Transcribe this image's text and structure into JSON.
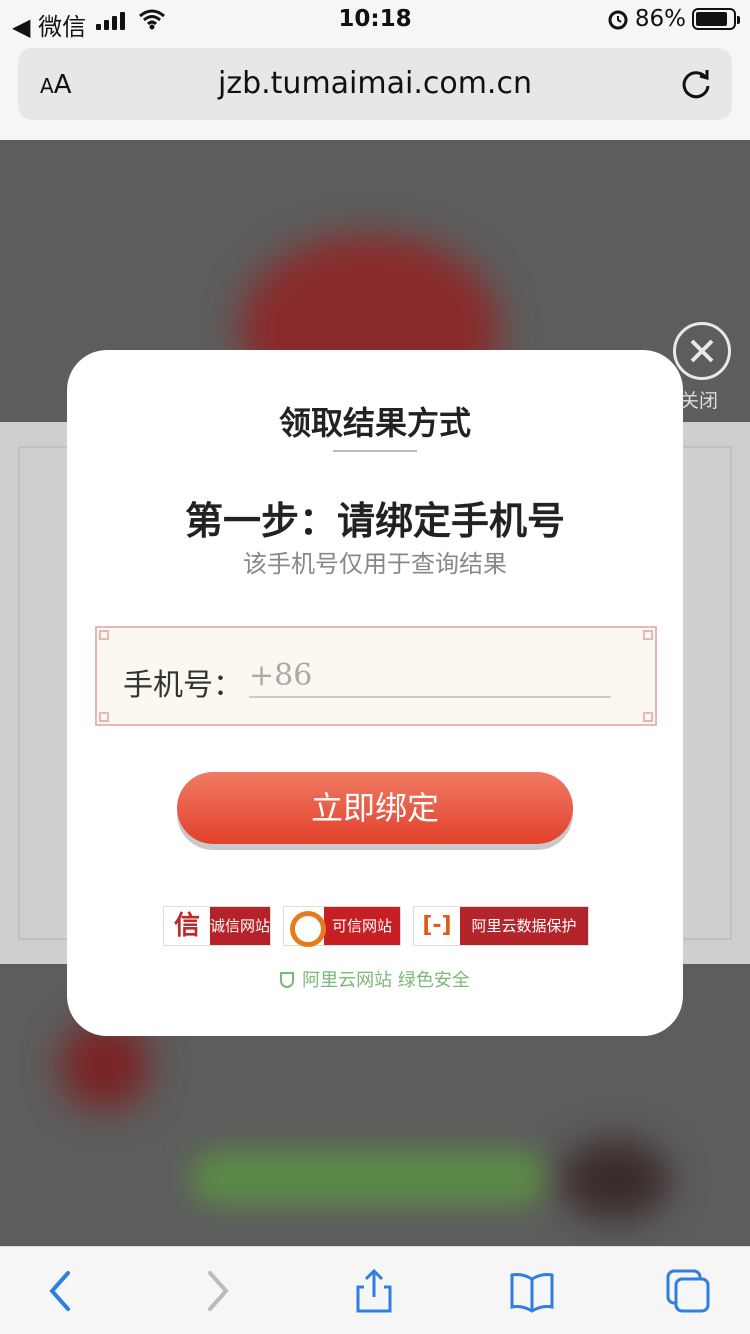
{
  "status_bar": {
    "back_label": "◀ 微信",
    "time": "10:18",
    "battery_percent": "86%",
    "battery_level": 0.86,
    "alarm_icon": "alarm-clock-icon",
    "wifi_icon": "wifi-icon",
    "signal_icon": "cellular-signal-icon"
  },
  "browser": {
    "text_size_label": "AA",
    "url": "jzb.tumaimai.com.cn",
    "reload_icon": "reload-icon"
  },
  "overlay": {
    "close_label": "关闭"
  },
  "modal": {
    "title": "领取结果方式",
    "step_title": "第一步：请绑定手机号",
    "subtitle": "该手机号仅用于查询结果",
    "phone_label": "手机号：",
    "phone_placeholder": "+86",
    "phone_value": "",
    "bind_button": "立即绑定",
    "badges": [
      {
        "icon_text": "信",
        "label": "诚信网站"
      },
      {
        "icon_text": "",
        "label": "可信网站"
      },
      {
        "icon_text": "[-]",
        "label": "阿里云数据保护"
      }
    ],
    "security_note": "阿里云网站 绿色安全"
  },
  "colors": {
    "accent_red": "#e2412d",
    "secure_green": "#7ab977",
    "ios_blue": "#2f7ee0"
  },
  "toolbar_icons": [
    "back-arrow-icon",
    "forward-arrow-icon",
    "share-icon",
    "bookmarks-icon",
    "tabs-icon"
  ]
}
